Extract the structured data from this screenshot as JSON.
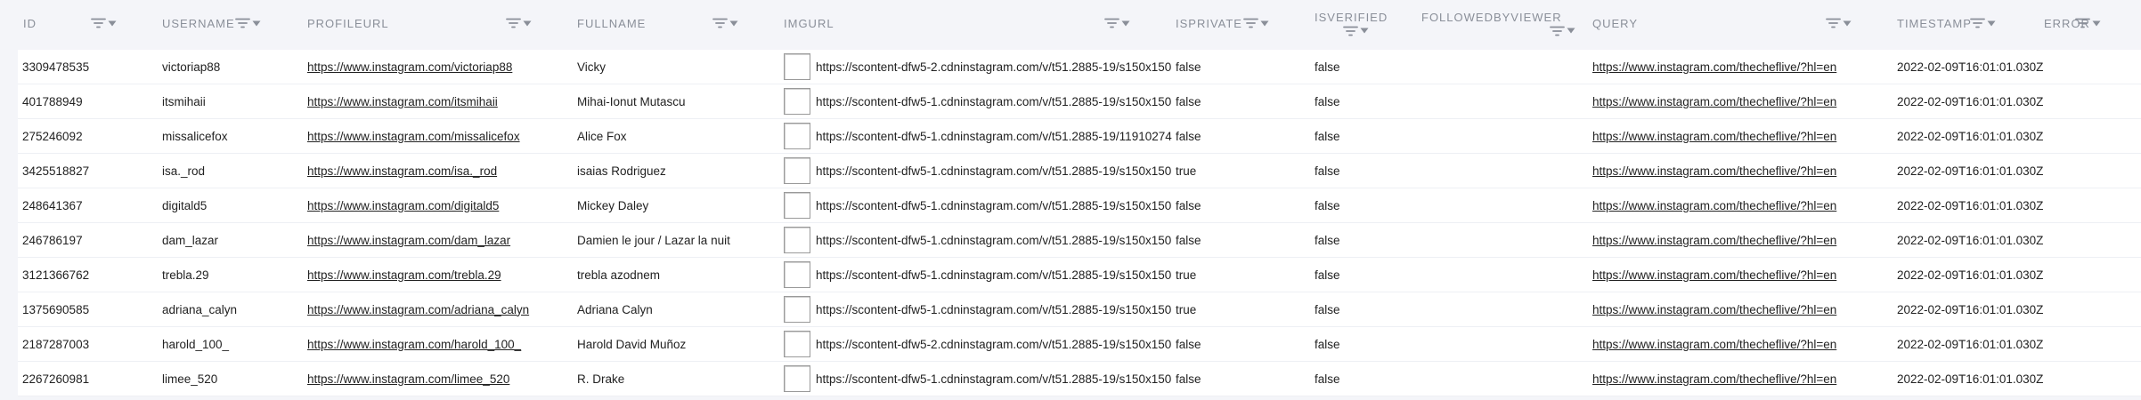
{
  "columns": [
    {
      "key": "id",
      "label": "ID"
    },
    {
      "key": "username",
      "label": "USERNAME"
    },
    {
      "key": "profileurl",
      "label": "PROFILEURL"
    },
    {
      "key": "fullname",
      "label": "FULLNAME"
    },
    {
      "key": "imgurl",
      "label": "IMGURL"
    },
    {
      "key": "isprivate",
      "label": "ISPRIVATE"
    },
    {
      "key": "isverified",
      "label": "ISVERIFIED"
    },
    {
      "key": "followedbyviewer",
      "label": "FOLLOWEDBYVIEWER"
    },
    {
      "key": "query",
      "label": "QUERY"
    },
    {
      "key": "timestamp",
      "label": "TIMESTAMP"
    },
    {
      "key": "error",
      "label": "ERROR"
    }
  ],
  "rows": [
    {
      "id": "3309478535",
      "username": "victoriap88",
      "profileurl": "https://www.instagram.com/victoriap88",
      "fullname": "Vicky",
      "imgurl": "https://scontent-dfw5-2.cdninstagram.com/v/t51.2885-19/s150x150",
      "isprivate": "false",
      "isverified": "false",
      "query": "https://www.instagram.com/thecheflive/?hl=en",
      "timestamp": "2022-02-09T16:01:01.030Z"
    },
    {
      "id": "401788949",
      "username": "itsmihaii",
      "profileurl": "https://www.instagram.com/itsmihaii",
      "fullname": "Mihai-Ionut Mutascu",
      "imgurl": "https://scontent-dfw5-1.cdninstagram.com/v/t51.2885-19/s150x150",
      "isprivate": "false",
      "isverified": "false",
      "query": "https://www.instagram.com/thecheflive/?hl=en",
      "timestamp": "2022-02-09T16:01:01.030Z"
    },
    {
      "id": "275246092",
      "username": "missalicefox",
      "profileurl": "https://www.instagram.com/missalicefox",
      "fullname": "Alice Fox",
      "imgurl": "https://scontent-dfw5-1.cdninstagram.com/v/t51.2885-19/11910274",
      "isprivate": "false",
      "isverified": "false",
      "query": "https://www.instagram.com/thecheflive/?hl=en",
      "timestamp": "2022-02-09T16:01:01.030Z"
    },
    {
      "id": "3425518827",
      "username": "isa._rod",
      "profileurl": "https://www.instagram.com/isa._rod",
      "fullname": "isaias Rodriguez",
      "imgurl": "https://scontent-dfw5-1.cdninstagram.com/v/t51.2885-19/s150x150",
      "isprivate": "true",
      "isverified": "false",
      "query": "https://www.instagram.com/thecheflive/?hl=en",
      "timestamp": "2022-02-09T16:01:01.030Z"
    },
    {
      "id": "248641367",
      "username": "digitald5",
      "profileurl": "https://www.instagram.com/digitald5",
      "fullname": "Mickey Daley",
      "imgurl": "https://scontent-dfw5-1.cdninstagram.com/v/t51.2885-19/s150x150",
      "isprivate": "false",
      "isverified": "false",
      "query": "https://www.instagram.com/thecheflive/?hl=en",
      "timestamp": "2022-02-09T16:01:01.030Z"
    },
    {
      "id": "246786197",
      "username": "dam_lazar",
      "profileurl": "https://www.instagram.com/dam_lazar",
      "fullname": "Damien le jour / Lazar la nuit",
      "imgurl": "https://scontent-dfw5-1.cdninstagram.com/v/t51.2885-19/s150x150",
      "isprivate": "false",
      "isverified": "false",
      "query": "https://www.instagram.com/thecheflive/?hl=en",
      "timestamp": "2022-02-09T16:01:01.030Z"
    },
    {
      "id": "3121366762",
      "username": "trebla.29",
      "profileurl": "https://www.instagram.com/trebla.29",
      "fullname": "trebla azodnem",
      "imgurl": "https://scontent-dfw5-1.cdninstagram.com/v/t51.2885-19/s150x150",
      "isprivate": "true",
      "isverified": "false",
      "query": "https://www.instagram.com/thecheflive/?hl=en",
      "timestamp": "2022-02-09T16:01:01.030Z"
    },
    {
      "id": "1375690585",
      "username": "adriana_calyn",
      "profileurl": "https://www.instagram.com/adriana_calyn",
      "fullname": "Adriana Calyn",
      "imgurl": "https://scontent-dfw5-1.cdninstagram.com/v/t51.2885-19/s150x150",
      "isprivate": "true",
      "isverified": "false",
      "query": "https://www.instagram.com/thecheflive/?hl=en",
      "timestamp": "2022-02-09T16:01:01.030Z"
    },
    {
      "id": "2187287003",
      "username": "harold_100_",
      "profileurl": "https://www.instagram.com/harold_100_",
      "fullname": "Harold David Muñoz",
      "imgurl": "https://scontent-dfw5-2.cdninstagram.com/v/t51.2885-19/s150x150",
      "isprivate": "false",
      "isverified": "false",
      "query": "https://www.instagram.com/thecheflive/?hl=en",
      "timestamp": "2022-02-09T16:01:01.030Z"
    },
    {
      "id": "2267260981",
      "username": "limee_520",
      "profileurl": "https://www.instagram.com/limee_520",
      "fullname": "R. Drake",
      "imgurl": "https://scontent-dfw5-1.cdninstagram.com/v/t51.2885-19/s150x150",
      "isprivate": "false",
      "isverified": "false",
      "query": "https://www.instagram.com/thecheflive/?hl=en",
      "timestamp": "2022-02-09T16:01:01.030Z"
    }
  ],
  "colors": {
    "header_text": "#8a8f99",
    "row_bg": "#ffffff",
    "page_bg": "#f4f5f9"
  },
  "icons": {
    "filter": "filter-icon",
    "sort": "chevron-down-icon",
    "image": "broken-image-icon"
  }
}
